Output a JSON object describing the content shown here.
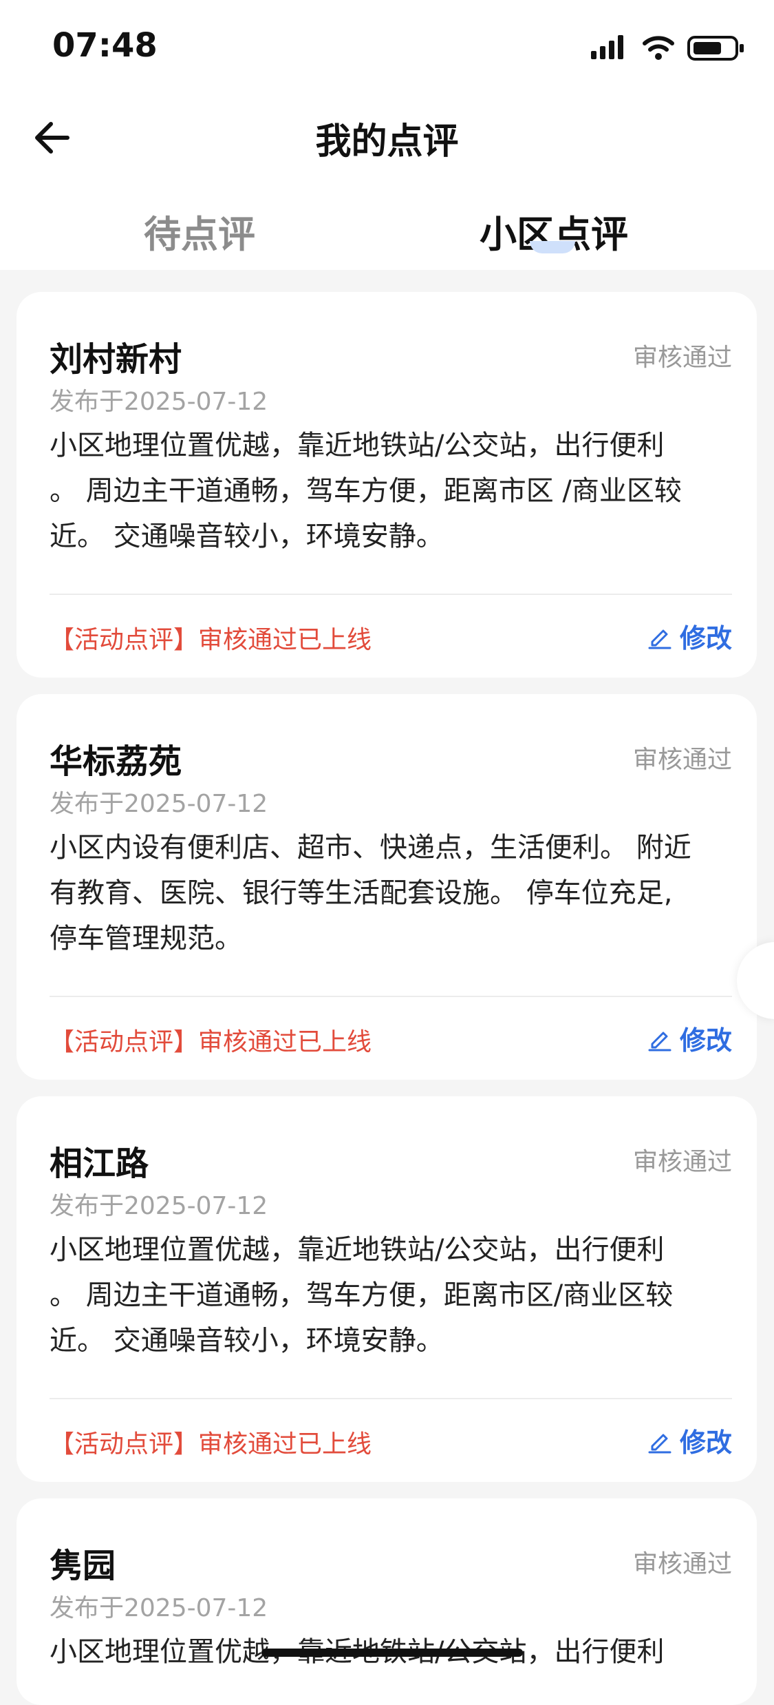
{
  "status_bar": {
    "time": "07:48"
  },
  "header": {
    "title": "我的点评"
  },
  "tabs": [
    {
      "label": "待点评",
      "active": false
    },
    {
      "label": "小区点评",
      "active": true
    }
  ],
  "reviews": [
    {
      "name": "刘村新村",
      "status": "审核通过",
      "date": "发布于2025-07-12",
      "text": "小区地理位置优越，靠近地铁站/公交站，出行便利\n。 周边主干道通畅，驾车方便，距离市区 /商业区较\n近。  交通噪音较小，环境安静。",
      "tag": "【活动点评】审核通过已上线",
      "edit_label": "修改"
    },
    {
      "name": "华标荔苑",
      "status": "审核通过",
      "date": "发布于2025-07-12",
      "text": "小区内设有便利店、超市、快递点，生活便利。 附近\n有教育、医院、银行等生活配套设施。 停车位充足,\n停车管理规范。",
      "tag": "【活动点评】审核通过已上线",
      "edit_label": "修改"
    },
    {
      "name": "相江路",
      "status": "审核通过",
      "date": "发布于2025-07-12",
      "text": "小区地理位置优越，靠近地铁站/公交站，出行便利\n。 周边主干道通畅，驾车方便，距离市区/商业区较\n近。 交通噪音较小，环境安静。",
      "tag": "【活动点评】审核通过已上线",
      "edit_label": "修改"
    },
    {
      "name": "隽园",
      "status": "审核通过",
      "date": "发布于2025-07-12",
      "text": "小区地理位置优越，靠近地铁站/公交站，出行便利",
      "tag": "",
      "edit_label": ""
    }
  ],
  "colors": {
    "accent": "#2f6de1",
    "tag": "#e24b3b",
    "muted": "#999999"
  },
  "icons": [
    "back-arrow-icon",
    "signal-icon",
    "wifi-icon",
    "battery-icon",
    "edit-pen-icon"
  ]
}
